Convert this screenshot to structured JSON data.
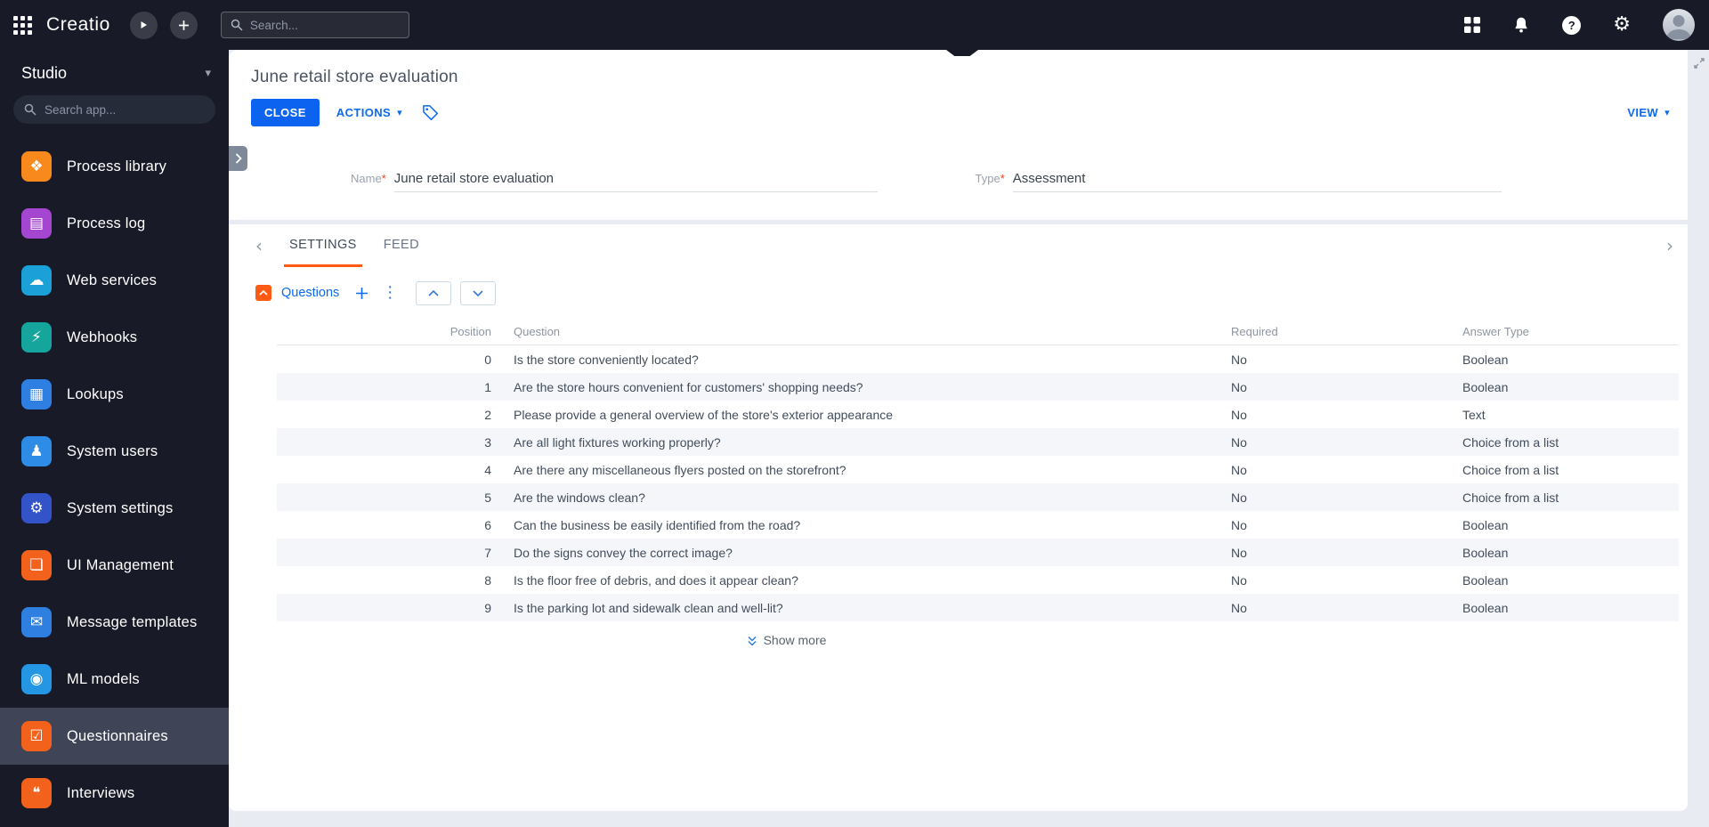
{
  "colors": {
    "topbar_bg": "#181b27",
    "sidebar_bg": "#181b27",
    "sidebar_selected_bg": "#3f4456",
    "canvas_bg": "#e8ebf1",
    "card_bg": "#ffffff",
    "accent_blue": "#0b6af2",
    "accent_orange": "#ff5a13",
    "required_mark_color": "#e8431f",
    "row_alt_bg": "#f5f6f9"
  },
  "topbar": {
    "logo": "Creatio",
    "search_placeholder": "Search...",
    "help_glyph": "?",
    "gear_glyph": "⚙"
  },
  "sidebar": {
    "workspace": "Studio",
    "workspace_caret": "▾",
    "search_placeholder": "Search app...",
    "selected_index": 10,
    "items": [
      {
        "id": "process-library",
        "label": "Process library",
        "color": "#f8891c",
        "glyph": "❖"
      },
      {
        "id": "process-log",
        "label": "Process log",
        "color": "#a446cf",
        "glyph": "▤"
      },
      {
        "id": "web-services",
        "label": "Web services",
        "color": "#1ba0d8",
        "glyph": "☁"
      },
      {
        "id": "webhooks",
        "label": "Webhooks",
        "color": "#16a59d",
        "glyph": "⚡"
      },
      {
        "id": "lookups",
        "label": "Lookups",
        "color": "#2f7fe3",
        "glyph": "▦"
      },
      {
        "id": "system-users",
        "label": "System users",
        "color": "#2e8be6",
        "glyph": "♟"
      },
      {
        "id": "system-settings",
        "label": "System settings",
        "color": "#3354c9",
        "glyph": "⚙"
      },
      {
        "id": "ui-management",
        "label": "UI Management",
        "color": "#f2621d",
        "glyph": "❏"
      },
      {
        "id": "message-templates",
        "label": "Message templates",
        "color": "#2e7fe0",
        "glyph": "✉"
      },
      {
        "id": "ml-models",
        "label": "ML models",
        "color": "#2496e4",
        "glyph": "◉"
      },
      {
        "id": "questionnaires",
        "label": "Questionnaires",
        "color": "#f2621d",
        "glyph": "☑"
      },
      {
        "id": "interviews",
        "label": "Interviews",
        "color": "#f2621d",
        "glyph": "❝"
      }
    ]
  },
  "record": {
    "title": "June retail store evaluation",
    "toolbar": {
      "close": "CLOSE",
      "actions": "ACTIONS",
      "view": "VIEW",
      "caret": "▾"
    },
    "required_mark": "*",
    "fields": [
      {
        "label": "Name",
        "value": "June retail store evaluation"
      },
      {
        "label": "Type",
        "value": "Assessment"
      }
    ],
    "tabs": [
      {
        "label": "SETTINGS",
        "active": true
      },
      {
        "label": "FEED",
        "active": false
      }
    ],
    "tab_scroll_left": "‹",
    "tab_scroll_right": "›",
    "section": {
      "title": "Questions",
      "kebab": "⋮"
    },
    "table": {
      "columns": [
        "Position",
        "Question",
        "Required",
        "Answer Type"
      ],
      "rows": [
        {
          "position": "0",
          "question": "Is the store conveniently located?",
          "required": "No",
          "answer_type": "Boolean"
        },
        {
          "position": "1",
          "question": "Are the store hours convenient for customers' shopping needs?",
          "required": "No",
          "answer_type": "Boolean"
        },
        {
          "position": "2",
          "question": "Please provide a general overview of the store's exterior appearance",
          "required": "No",
          "answer_type": "Text"
        },
        {
          "position": "3",
          "question": "Are all light fixtures working properly?",
          "required": "No",
          "answer_type": "Choice from a list"
        },
        {
          "position": "4",
          "question": "Are there any miscellaneous flyers posted on the storefront?",
          "required": "No",
          "answer_type": "Choice from a list"
        },
        {
          "position": "5",
          "question": "Are the windows clean?",
          "required": "No",
          "answer_type": "Choice from a list"
        },
        {
          "position": "6",
          "question": "Can the business be easily identified from the road?",
          "required": "No",
          "answer_type": "Boolean"
        },
        {
          "position": "7",
          "question": "Do the signs convey the correct image?",
          "required": "No",
          "answer_type": "Boolean"
        },
        {
          "position": "8",
          "question": "Is the floor free of debris, and does it appear clean?",
          "required": "No",
          "answer_type": "Boolean"
        },
        {
          "position": "9",
          "question": "Is the parking lot and sidewalk clean and well-lit?",
          "required": "No",
          "answer_type": "Boolean"
        }
      ]
    },
    "show_more": "Show more"
  }
}
